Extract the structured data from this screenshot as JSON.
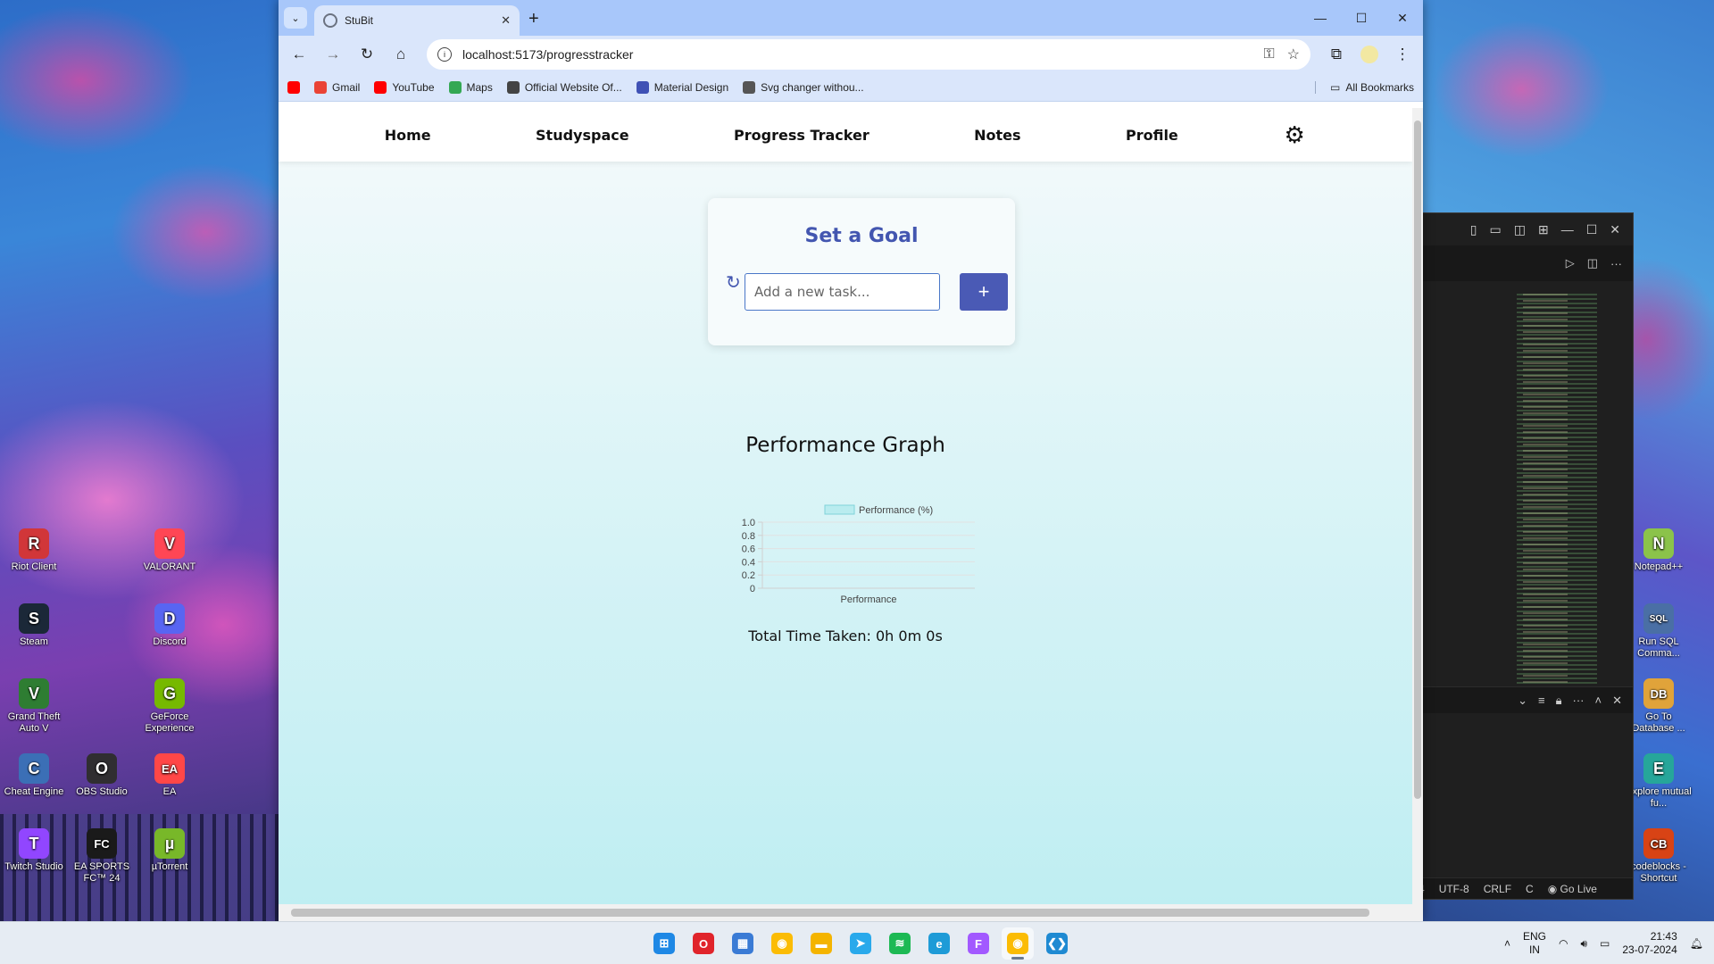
{
  "desktop": {
    "left_icons": [
      {
        "label": "Riot Client",
        "icon": "riot-icon",
        "color": "#d13639",
        "glyph": "R"
      },
      {
        "label": "VALORANT",
        "icon": "valorant-icon",
        "color": "#ff4655",
        "glyph": "V"
      },
      {
        "label": "Steam",
        "icon": "steam-icon",
        "color": "#1b2838",
        "glyph": "S"
      },
      {
        "label": "Discord",
        "icon": "discord-icon",
        "color": "#5865f2",
        "glyph": "D"
      },
      {
        "label": "Grand Theft Auto V",
        "icon": "gta-icon",
        "color": "#2e7d32",
        "glyph": "V"
      },
      {
        "label": "GeForce Experience",
        "icon": "geforce-icon",
        "color": "#76b900",
        "glyph": "G"
      },
      {
        "label": "Cheat Engine",
        "icon": "cheat-engine-icon",
        "color": "#3b6fb6",
        "glyph": "C"
      },
      {
        "label": "OBS Studio",
        "icon": "obs-icon",
        "color": "#302e31",
        "glyph": "O"
      },
      {
        "label": "EA",
        "icon": "ea-icon",
        "color": "#ff4747",
        "glyph": "EA"
      },
      {
        "label": "Twitch Studio",
        "icon": "twitch-icon",
        "color": "#9146ff",
        "glyph": "T"
      },
      {
        "label": "EA SPORTS FC™ 24",
        "icon": "easports-icon",
        "color": "#1a1a1a",
        "glyph": "FC"
      },
      {
        "label": "µTorrent",
        "icon": "utorrent-icon",
        "color": "#78b829",
        "glyph": "µ"
      }
    ],
    "right_icons": [
      {
        "label": "Notepad++",
        "icon": "notepadpp-icon",
        "color": "#8bc34a",
        "glyph": "N"
      },
      {
        "label": "Run SQL Comma...",
        "icon": "sql-icon",
        "color": "#4a6fa5",
        "glyph": "SQL"
      },
      {
        "label": "Go To Database ...",
        "icon": "database-icon",
        "color": "#e0a33a",
        "glyph": "DB"
      },
      {
        "label": "Explore mutual fu...",
        "icon": "explore-icon",
        "color": "#26a69a",
        "glyph": "E"
      },
      {
        "label": "codeblocks - Shortcut",
        "icon": "codeblocks-icon",
        "color": "#d84315",
        "glyph": "CB"
      }
    ]
  },
  "vscode": {
    "status_items": [
      "4",
      "UTF-8",
      "CRLF",
      "C",
      "Go Live"
    ]
  },
  "browser": {
    "tab_title": "StuBit",
    "url": "localhost:5173/progresstracker",
    "bookmarks": [
      {
        "label": "",
        "color": "#ff0000"
      },
      {
        "label": "Gmail",
        "color": "#ea4335"
      },
      {
        "label": "YouTube",
        "color": "#ff0000"
      },
      {
        "label": "Maps",
        "color": "#34a853"
      },
      {
        "label": "Official Website Of...",
        "color": "#444444"
      },
      {
        "label": "Material Design",
        "color": "#3f51b5"
      },
      {
        "label": "Svg changer withou...",
        "color": "#555555"
      }
    ],
    "all_bookmarks": "All Bookmarks"
  },
  "page": {
    "nav": {
      "home": "Home",
      "studyspace": "Studyspace",
      "progress_tracker": "Progress Tracker",
      "notes": "Notes",
      "profile": "Profile"
    },
    "goal": {
      "title": "Set a Goal",
      "placeholder": "Add a new task...",
      "add_label": "+"
    },
    "performance_title": "Performance Graph",
    "total_time": "Total Time Taken: 0h 0m 0s"
  },
  "chart_data": {
    "type": "bar",
    "categories": [
      "Performance"
    ],
    "series": [
      {
        "name": "Performance (%)",
        "values": []
      }
    ],
    "ylim": [
      0,
      1.0
    ],
    "yticks": [
      "0",
      "0.2",
      "0.4",
      "0.6",
      "0.8",
      "1.0"
    ],
    "legend_color": "#b9ecef",
    "legend_border": "#7fd3d9",
    "grid": true,
    "legend_position": "top"
  },
  "taskbar": {
    "apps": [
      {
        "name": "start-icon",
        "color": "#1e88e5",
        "glyph": "⊞"
      },
      {
        "name": "opera-icon",
        "color": "#e0242b",
        "glyph": "O"
      },
      {
        "name": "store-icon",
        "color": "#3a7bd5",
        "glyph": "▦"
      },
      {
        "name": "chrome-icon",
        "color": "#fbbc05",
        "glyph": "◉"
      },
      {
        "name": "file-explorer-icon",
        "color": "#f4b400",
        "glyph": "▬"
      },
      {
        "name": "telegram-icon",
        "color": "#29a9eb",
        "glyph": "➤"
      },
      {
        "name": "spotify-icon",
        "color": "#1db954",
        "glyph": "≋"
      },
      {
        "name": "edge-icon",
        "color": "#1e9bd7",
        "glyph": "e"
      },
      {
        "name": "figma-icon",
        "color": "#a259ff",
        "glyph": "F"
      },
      {
        "name": "chrome-profile-icon",
        "color": "#fbbc05",
        "glyph": "◉"
      },
      {
        "name": "vscode-icon",
        "color": "#1f8ad2",
        "glyph": "❮❯"
      }
    ],
    "lang_line1": "ENG",
    "lang_line2": "IN",
    "time": "21:43",
    "date": "23-07-2024"
  }
}
